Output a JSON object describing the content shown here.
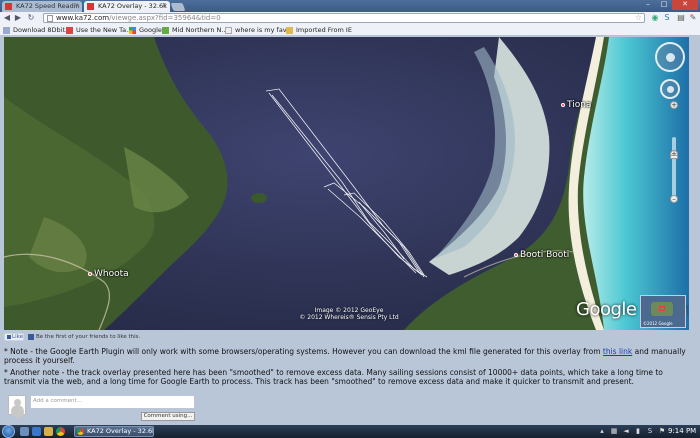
{
  "browser": {
    "tabs": [
      {
        "label": "KA72 Speed Readin",
        "active": false
      },
      {
        "label": "KA72 Overlay - 32.6k",
        "active": true
      }
    ],
    "url_host": "www.ka72.com",
    "url_path": "/viewge.aspx?fid=35964&tid=0"
  },
  "bookmarks": [
    {
      "label": "Download 8Dbit..."
    },
    {
      "label": "Use the New Ta..."
    },
    {
      "label": "Google"
    },
    {
      "label": "Mid Northern N..."
    },
    {
      "label": "where is my fav..."
    },
    {
      "label": "Imported From IE"
    }
  ],
  "map": {
    "labels": {
      "tiona": "Tiona",
      "booti_booti": "Booti Booti",
      "whoota": "Whoota"
    },
    "copyright_line1": "Image © 2012 GeoEye",
    "copyright_line2": "© 2012 Whereis® Sensis Pty Ltd",
    "logo_text": "Google earth",
    "overview_caption": "©2012 Google"
  },
  "facebook": {
    "like_label": "Like",
    "prompt": "Be the first of your friends to like this."
  },
  "notes": {
    "note1_before_link": "* Note - the Google Earth Plugin will only work with some browsers/operating systems. However you can download the kml file generated for this overlay from ",
    "note1_link": "this link",
    "note1_after_link": " and manually process it yourself.",
    "note2": "* Another note - the track overlay presented here has been \"smoothed\" to remove excess data. Many sailing sessions consist of 10000+ data points, which take a long time to transmit via the web, and a long time for Google Earth to process. This track has been \"smoothed\" to remove excess data and make it quicker to transmit and present."
  },
  "comments": {
    "placeholder": "Add a comment...",
    "button_label": "Comment using..."
  },
  "taskbar": {
    "task_label": "KA72 Overlay - 32.6k...",
    "clock": "9:14 PM"
  }
}
